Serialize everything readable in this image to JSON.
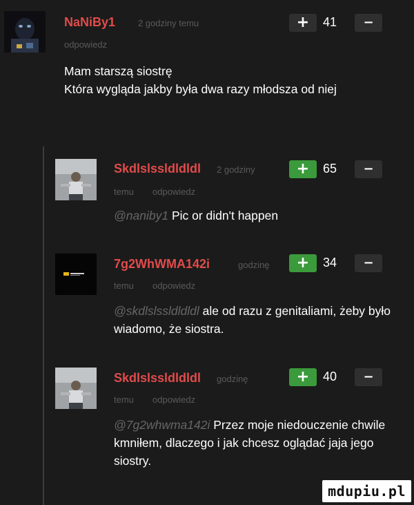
{
  "comments": [
    {
      "username": "NaNiBy1",
      "time": "2 godziny temu",
      "reply": "odpowiedz",
      "score": "41",
      "plus": "+",
      "minus": "−",
      "mention": "",
      "text": "Mam starszą siostrę\nKtóra wygląda jakby była dwa razy młodsza od niej",
      "plus_active": false
    },
    {
      "username": "Skdlslssldldldl",
      "time": "2 godziny",
      "time2": "temu",
      "reply": "odpowiedz",
      "score": "65",
      "plus": "+",
      "minus": "−",
      "mention": "@naniby1",
      "text": "Pic or didn't happen",
      "plus_active": true
    },
    {
      "username": "7g2WhWMA142i",
      "time": "godzinę",
      "time2": "temu",
      "reply": "odpowiedz",
      "score": "34",
      "plus": "+",
      "minus": "−",
      "mention": "@skdlslssldldldl",
      "text": "ale od razu z genitaliami, żeby było wiadomo, że siostra.",
      "plus_active": true
    },
    {
      "username": "Skdlslssldldldl",
      "time": "godzinę",
      "time2": "temu",
      "reply": "odpowiedz",
      "score": "40",
      "plus": "+",
      "minus": "−",
      "mention": "@7g2whwma142i",
      "text": "Przez moje niedouczenie chwile kmniłem, dlaczego i jak chcesz oglądać jaja jego siostry.",
      "plus_active": true
    }
  ],
  "watermark": "mdupiu.pl",
  "colors": {
    "background": "#1b1b1b",
    "username": "#e14b4b",
    "meta": "#5a5a5a",
    "plus_active": "#3b9a3b",
    "button": "#2f2f2f"
  }
}
